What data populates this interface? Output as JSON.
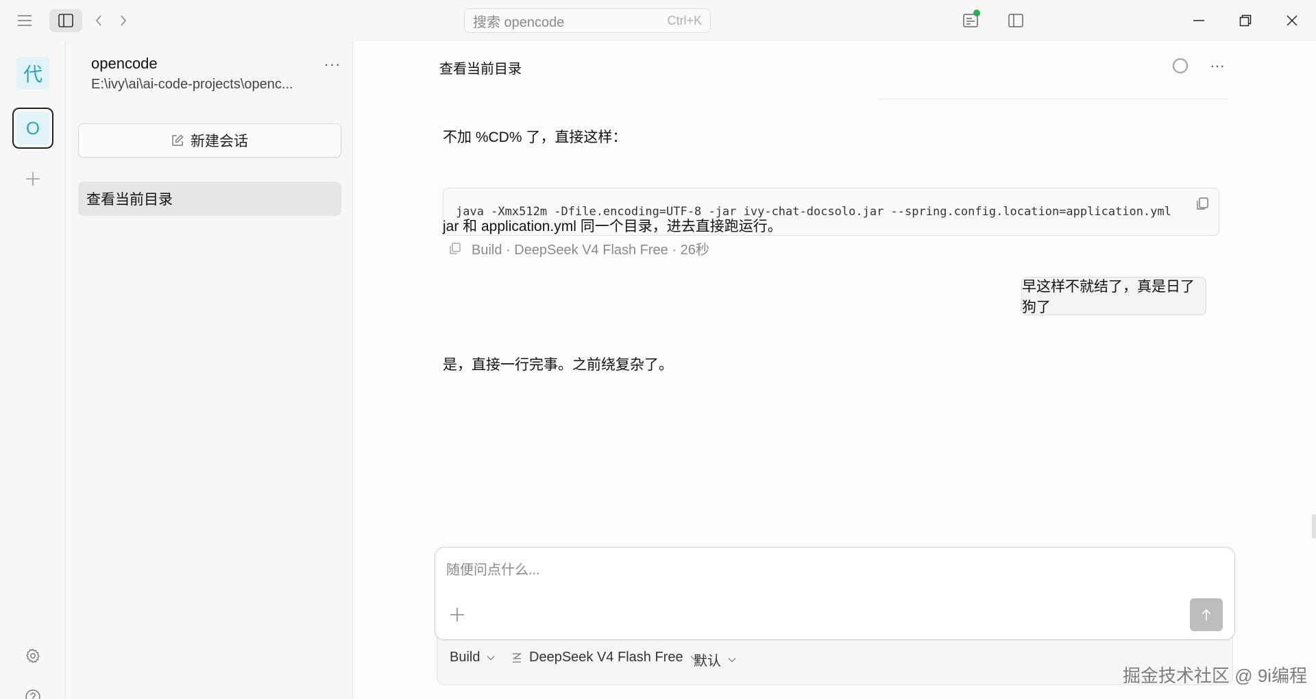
{
  "titlebar": {
    "search_placeholder": "搜索 opencode",
    "search_shortcut": "Ctrl+K"
  },
  "rail": {
    "projects": [
      {
        "label": "代",
        "color": "#2aa6c7"
      },
      {
        "label": "O",
        "color": "#2aa6c7",
        "selected": true
      }
    ]
  },
  "sidebar": {
    "project_name": "opencode",
    "project_path": "E:\\ivy\\ai\\ai-code-projects\\openc...",
    "new_session_label": "新建会话",
    "sessions": [
      {
        "title": "查看当前目录",
        "active": true
      }
    ]
  },
  "conversation": {
    "title": "查看当前目录",
    "assistant_intro": "不加 %CD% 了，直接这样：",
    "code": "java -Xmx512m -Dfile.encoding=UTF-8 -jar ivy-chat-docsolo.jar --spring.config.location=application.yml",
    "assistant_followup": "jar 和 application.yml 同一个目录，进去直接跑运行。",
    "meta": "Build · DeepSeek V4 Flash Free · 26秒",
    "user_message": "早这样不就结了，真是日了狗了",
    "assistant_reply": "是，直接一行完事。之前绕复杂了。"
  },
  "composer": {
    "placeholder": "随便问点什么...",
    "agent": "Build",
    "model": "DeepSeek V4 Flash Free",
    "variant": "默认"
  },
  "watermark": "掘金技术社区 @ 9i编程",
  "colors": {
    "accent_project": "#2aa6c7",
    "status_dot": "#22b34a",
    "send_button": "#bdbdbd"
  }
}
